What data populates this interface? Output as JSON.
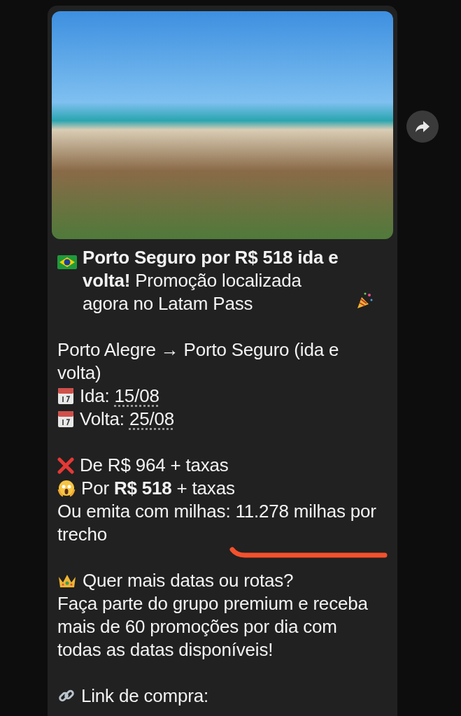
{
  "message": {
    "intro": "**Porto Seguro por R$ 518 ida e volta!** Promoção localizada agora no Latam Pass",
    "route": "Porto Alegre → Porto Seguro (ida e volta)",
    "dates": [
      {
        "label": "Ida:",
        "date": "15/08"
      },
      {
        "label": "Volta:",
        "date": "25/08"
      }
    ],
    "old_price": "De R$ 964 + taxas",
    "new_price": "Por **R$ 518** + taxas",
    "miles": "Ou emita com milhas: 11.278 milhas por trecho",
    "premium_title": "Quer mais datas ou rotas?",
    "premium_text": "Faça parte do grupo premium e receba mais de 60 promoções por dia com todas as datas disponíveis!",
    "link_label": "Link de compra:"
  }
}
